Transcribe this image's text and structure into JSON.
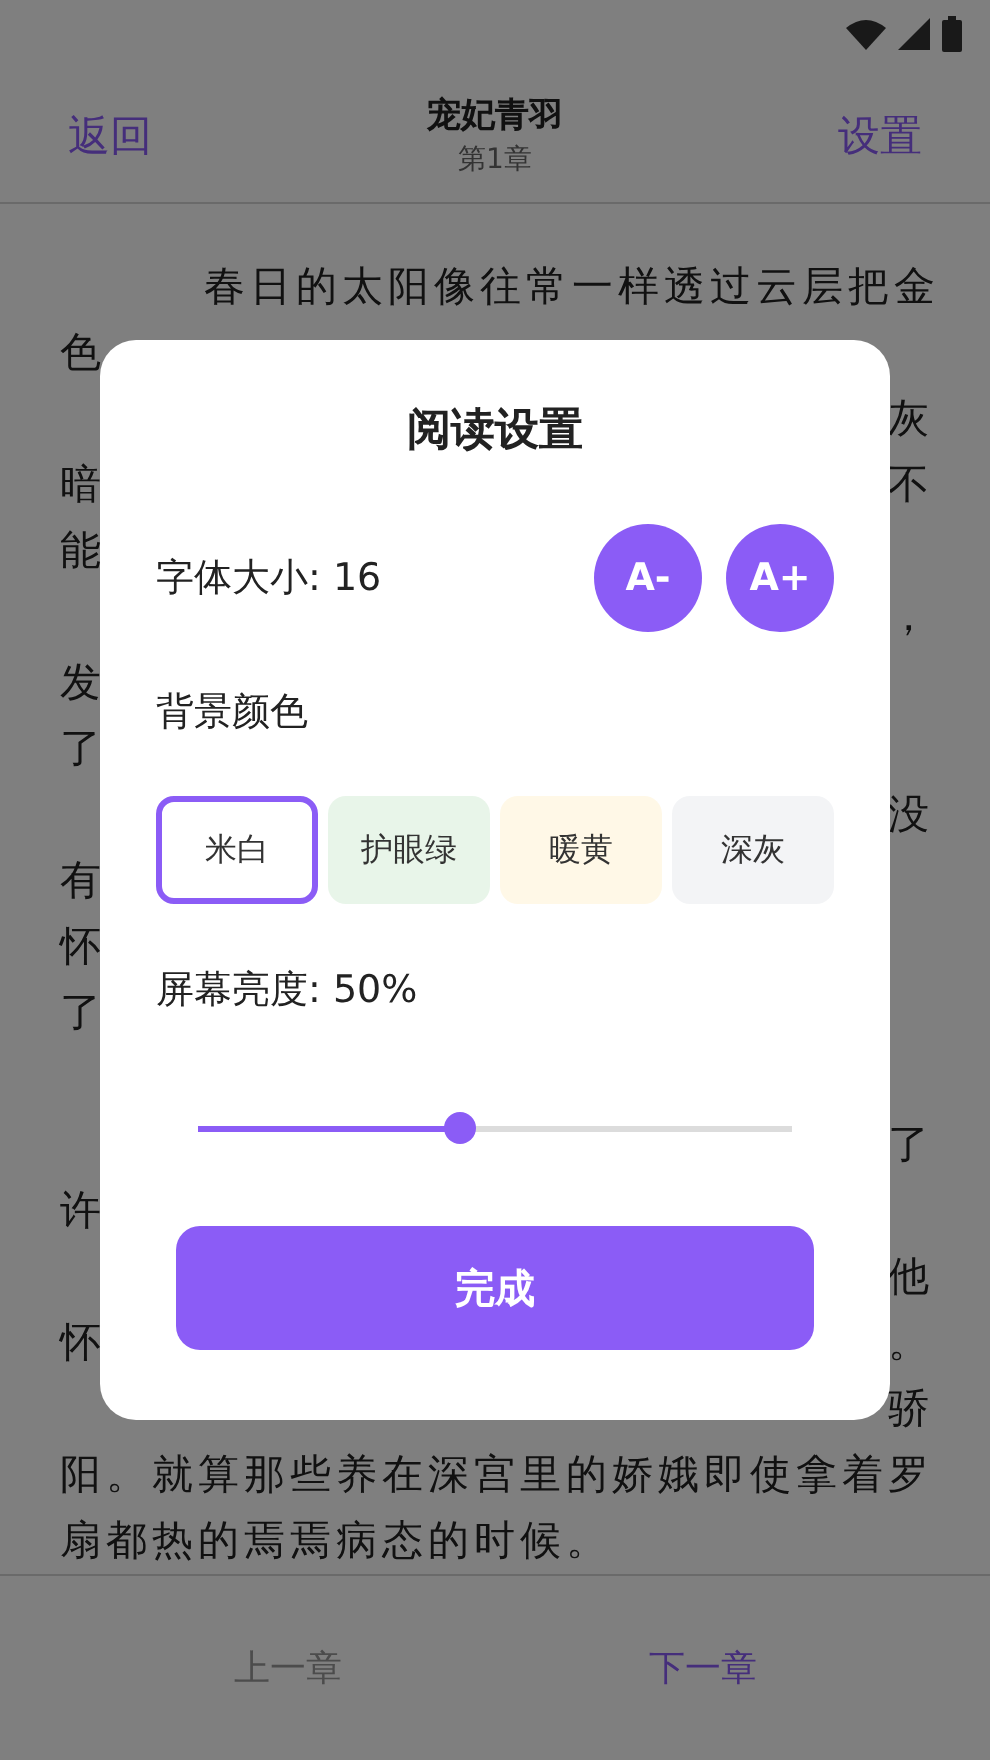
{
  "header": {
    "back": "返回",
    "title": "宠妃青羽",
    "subtitle": "第1章",
    "settings": "设置"
  },
  "lines": [
    {
      "left": "春日的太阳像往常一样透过云层把金",
      "indent": true
    },
    {
      "left": "色"
    },
    {
      "right": "灰"
    },
    {
      "left": "暗",
      "right": "不"
    },
    {
      "left": "能"
    },
    {
      "right": "，"
    },
    {
      "left": "发"
    },
    {
      "left": "了"
    },
    {
      "right": "没"
    },
    {
      "left": "有"
    },
    {
      "left": "怀"
    },
    {
      "left": "了"
    },
    {
      "right": "了",
      "gap_before": true
    },
    {
      "left": "许"
    },
    {
      "right": "他"
    },
    {
      "left": "怀",
      "right": "。"
    },
    {
      "right": "骄"
    },
    {
      "left": "阳。就算那些养在深宫里的娇娥即使拿着罗"
    },
    {
      "left": "扇都热的焉焉病态的时候。"
    }
  ],
  "footer": [
    {
      "label": "上一章",
      "enabled": false
    },
    {
      "label": "下一章",
      "enabled": true
    }
  ],
  "dialog": {
    "title": "阅读设置",
    "font_size_label": "字体大小: 16",
    "font_buttons": [
      "A-",
      "A+"
    ],
    "background_label": "背景颜色",
    "backgrounds": [
      {
        "label": "米白",
        "color": "#ffffff",
        "selected": true
      },
      {
        "label": "护眼绿",
        "color": "#e8f5e9",
        "selected": false
      },
      {
        "label": "暖黄",
        "color": "#fff8e7",
        "selected": false
      },
      {
        "label": "深灰",
        "color": "#f3f4f6",
        "selected": false
      }
    ],
    "brightness_label": "屏幕亮度: 50%",
    "brightness": {
      "level": 0.44
    },
    "done": "完成"
  }
}
